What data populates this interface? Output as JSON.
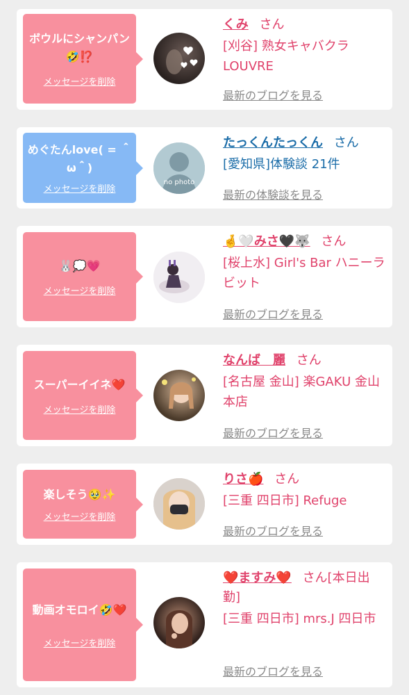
{
  "cards": [
    {
      "message": "ボウルにシャンパン🤣⁉️",
      "delete_label": "メッセージを削除",
      "name": "くみ",
      "honorific": "さん",
      "shop": "[刈谷] 熟女キャバクラLOUVRE",
      "blog_link": "最新のブログを見る",
      "avatar_desc": "photo"
    },
    {
      "message": "めぐたんlove( = ＾ω＾)",
      "delete_label": "メッセージを削除",
      "name": "たっくんたっくん",
      "honorific": "さん",
      "shop": "[愛知県]体験談 21件",
      "blog_link": "最新の体験談を見る",
      "avatar_text": "no photo"
    },
    {
      "message": "🐰💭💗",
      "delete_label": "メッセージを削除",
      "name": "🤞🤍みさ🖤🐺",
      "honorific": "さん",
      "shop": "[桜上水] Girl's Bar ハニーラビット",
      "blog_link": "最新のブログを見る",
      "avatar_desc": "photo"
    },
    {
      "message": "スーパーイイネ❤️",
      "delete_label": "メッセージを削除",
      "name": "なんば　麗",
      "honorific": "さん",
      "shop": "[名古屋 金山] 楽GAKU 金山本店",
      "blog_link": "最新のブログを見る",
      "avatar_desc": "photo"
    },
    {
      "message": "楽しそう🥹✨",
      "delete_label": "メッセージを削除",
      "name": "りさ🍎",
      "honorific": "さん",
      "shop": "[三重 四日市] Refuge",
      "blog_link": "最新のブログを見る",
      "avatar_desc": "photo"
    },
    {
      "message": "動画オモロイ🤣❤️",
      "delete_label": "メッセージを削除",
      "name": "❤️ますみ❤️",
      "honorific": "さん[本日出勤]",
      "shop": "[三重 四日市] mrs.J 四日市",
      "blog_link": "最新のブログを見る",
      "avatar_desc": "photo"
    }
  ],
  "colors": {
    "pink": "#f8909e",
    "blue": "#86b9f5",
    "text_pink": "#e0426b",
    "text_blue": "#1a6ca8",
    "link_gray": "#8a8a8a"
  }
}
